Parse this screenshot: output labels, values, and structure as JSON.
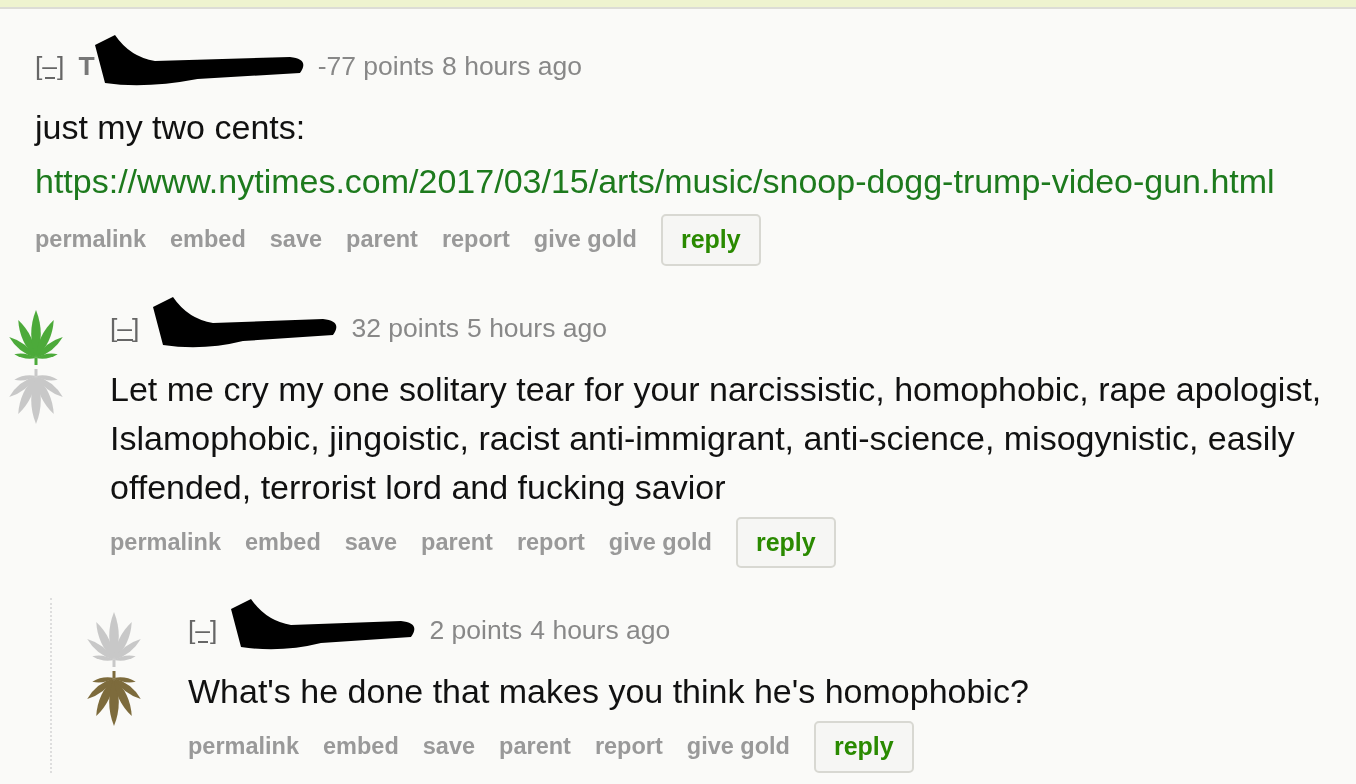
{
  "comments": [
    {
      "collapse": "[–]",
      "author": "T",
      "score": "-77 points",
      "time": "8 hours ago",
      "body": [
        {
          "kind": "text",
          "text": "just my two cents:"
        },
        {
          "kind": "link",
          "text": "https://www.nytimes.com/2017/03/15/arts/music/snoop-dogg-trump-video-gun.html"
        }
      ],
      "actions": [
        "permalink",
        "embed",
        "save",
        "parent",
        "report",
        "give gold"
      ],
      "reply": "reply",
      "children": [
        {
          "collapse": "[–]",
          "upvoted": true,
          "downvoted": false,
          "score": "32 points",
          "time": "5 hours ago",
          "body": [
            {
              "kind": "text",
              "text": "Let me cry my one solitary tear for your narcissistic, homophobic, rape apologist, Islamophobic, jingoistic, racist anti-immigrant, anti-science, misogynistic, easily offended, terrorist lord and fucking savior"
            }
          ],
          "actions": [
            "permalink",
            "embed",
            "save",
            "parent",
            "report",
            "give gold"
          ],
          "reply": "reply",
          "children": [
            {
              "collapse": "[–]",
              "upvoted": false,
              "downvoted": true,
              "score": "2 points",
              "time": "4 hours ago",
              "body": [
                {
                  "kind": "text",
                  "text": "What's he done that makes you think he's homophobic?"
                }
              ],
              "actions": [
                "permalink",
                "embed",
                "save",
                "parent",
                "report",
                "give gold"
              ],
              "reply": "reply"
            }
          ]
        }
      ]
    }
  ]
}
